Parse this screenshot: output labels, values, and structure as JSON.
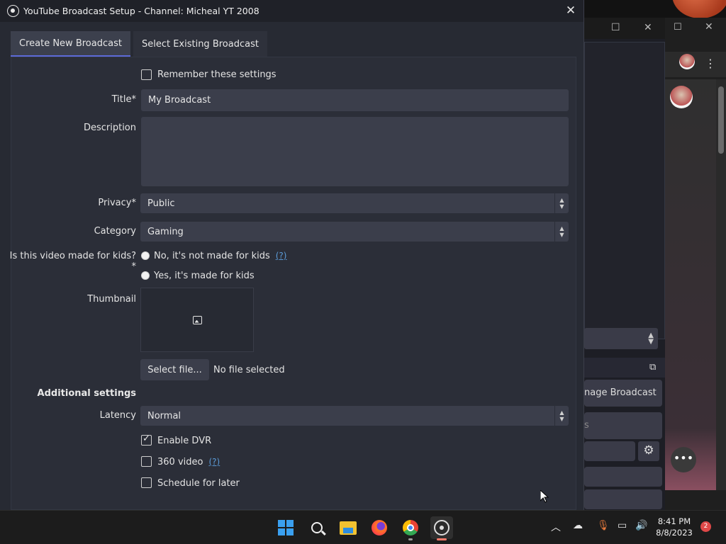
{
  "dialog": {
    "title": "YouTube Broadcast Setup - Channel: Micheal YT 2008",
    "close_glyph": "✕"
  },
  "tabs": [
    {
      "label": "Create New Broadcast",
      "active": true
    },
    {
      "label": "Select Existing Broadcast",
      "active": false
    }
  ],
  "form": {
    "remember_label": "Remember these settings",
    "remember_checked": false,
    "title_label": "Title*",
    "title_value": "My Broadcast",
    "description_label": "Description",
    "description_value": "",
    "privacy_label": "Privacy*",
    "privacy_value": "Public",
    "category_label": "Category",
    "category_value": "Gaming",
    "kids_label": "Is this video made for kids?*",
    "kids_no": "No, it's not made for kids",
    "kids_yes": "Yes, it's made for kids",
    "help_link": "(?)",
    "thumbnail_label": "Thumbnail",
    "select_file": "Select file...",
    "no_file": "No file selected",
    "additional_header": "Additional settings",
    "latency_label": "Latency",
    "latency_value": "Normal",
    "dvr_label": "Enable DVR",
    "dvr_checked": true,
    "video360_label": "360 video",
    "video360_checked": false,
    "schedule_label": "Schedule for later",
    "schedule_checked": false
  },
  "background": {
    "obs_button_manage": "nage Broadcast",
    "obs_button_partial": "s"
  },
  "taskbar": {
    "time": "8:41 PM",
    "date": "8/8/2023",
    "notifications": "2"
  }
}
